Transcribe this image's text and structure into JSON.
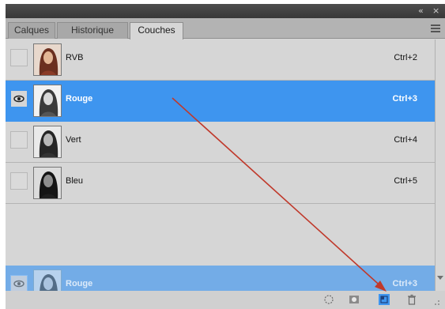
{
  "window": {
    "collapse_glyph": "«",
    "close_glyph": "×"
  },
  "tabs": [
    {
      "label": "Calques",
      "active": false
    },
    {
      "label": "Historique",
      "active": false
    },
    {
      "label": "Couches",
      "active": true
    }
  ],
  "channels": [
    {
      "name": "RVB",
      "shortcut": "Ctrl+2",
      "selected": false,
      "visible": false,
      "thumb": "color"
    },
    {
      "name": "Rouge",
      "shortcut": "Ctrl+3",
      "selected": true,
      "visible": true,
      "thumb": "gray"
    },
    {
      "name": "Vert",
      "shortcut": "Ctrl+4",
      "selected": false,
      "visible": false,
      "thumb": "gray"
    },
    {
      "name": "Bleu",
      "shortcut": "Ctrl+5",
      "selected": false,
      "visible": false,
      "thumb": "dark"
    }
  ],
  "drag_ghost": {
    "name": "Rouge",
    "shortcut": "Ctrl+3"
  },
  "bottom_icons": [
    "dotted-circle-icon",
    "mask-icon",
    "new-channel-icon",
    "trash-icon"
  ],
  "colors": {
    "selection": "#3e95ef",
    "panel_bg": "#d6d6d6",
    "annotation_arrow": "#c0392b"
  }
}
